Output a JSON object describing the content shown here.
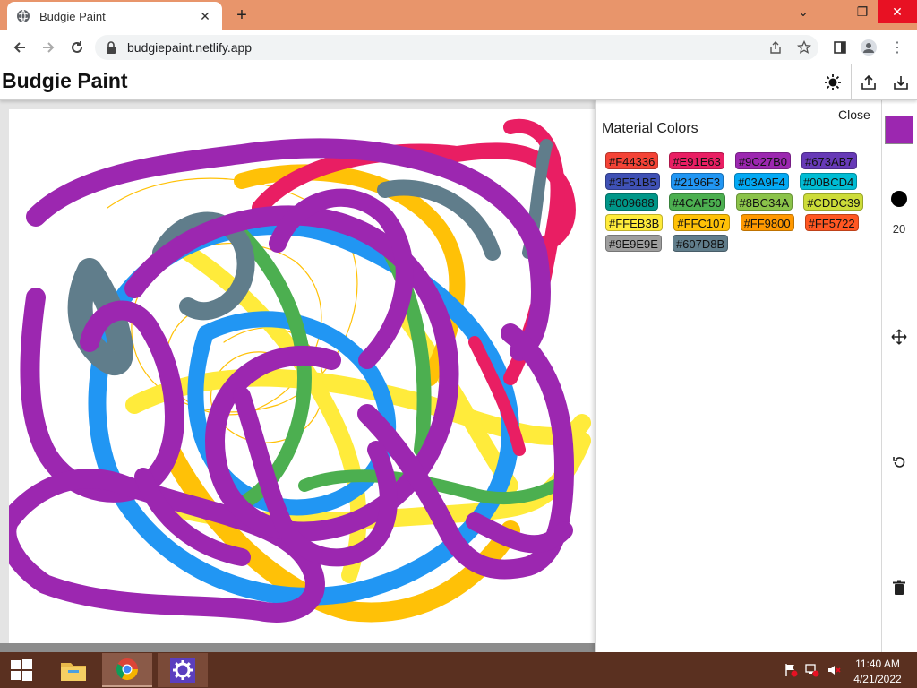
{
  "browser": {
    "tab_title": "Budgie Paint",
    "url": "budgiepaint.netlify.app",
    "new_tab_label": "+"
  },
  "app": {
    "title": "Budgie Paint",
    "icons": [
      "theme-sun-icon",
      "share-upload-icon",
      "download-icon"
    ]
  },
  "panel": {
    "close_label": "Close",
    "title": "Material Colors",
    "swatch_rows": [
      [
        {
          "label": "#F44336",
          "color": "#F44336"
        },
        {
          "label": "#E91E63",
          "color": "#E91E63"
        },
        {
          "label": "#9C27B0",
          "color": "#9C27B0"
        },
        {
          "label": "#673AB7",
          "color": "#673AB7"
        }
      ],
      [
        {
          "label": "#3F51B5",
          "color": "#3F51B5"
        },
        {
          "label": "#2196F3",
          "color": "#2196F3"
        },
        {
          "label": "#03A9F4",
          "color": "#03A9F4"
        },
        {
          "label": "#00BCD4",
          "color": "#00BCD4"
        }
      ],
      [
        {
          "label": "#009688",
          "color": "#009688"
        },
        {
          "label": "#4CAF50",
          "color": "#4CAF50"
        },
        {
          "label": "#8BC34A",
          "color": "#8BC34A"
        },
        {
          "label": "#CDDC39",
          "color": "#CDDC39"
        }
      ],
      [
        {
          "label": "#FFEB3B",
          "color": "#FFEB3B"
        },
        {
          "label": "#FFC107",
          "color": "#FFC107"
        },
        {
          "label": "#FF9800",
          "color": "#FF9800"
        },
        {
          "label": "#FF5722",
          "color": "#FF5722"
        }
      ],
      [
        {
          "label": "#9E9E9E",
          "color": "#9E9E9E"
        },
        {
          "label": "#607D8B",
          "color": "#607D8B"
        }
      ]
    ]
  },
  "toolbar": {
    "current_color": "#9C27B0",
    "brush_size": "20",
    "icons": [
      "move-icon",
      "undo-icon",
      "trash-icon"
    ]
  },
  "taskbar": {
    "time": "11:40 AM",
    "date": "4/21/2022",
    "apps": [
      "file-explorer-icon",
      "chrome-icon",
      "settings-icon"
    ]
  },
  "colors": {
    "titlebar": "#e8956b",
    "taskbar": "#5a3020",
    "close_red": "#e81123"
  }
}
